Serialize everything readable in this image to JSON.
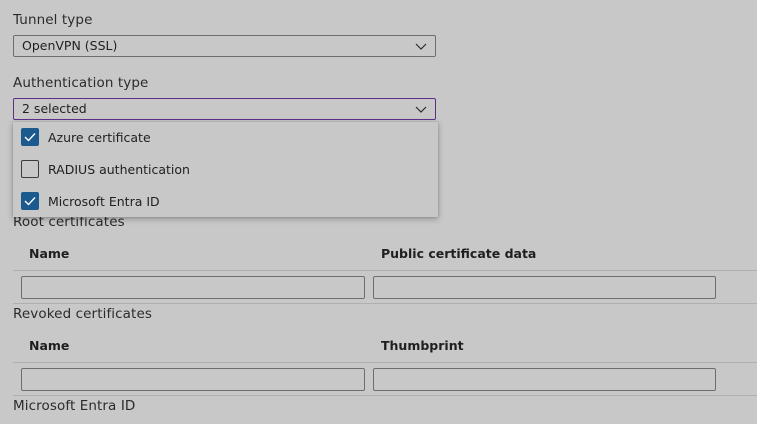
{
  "tunnel_type": {
    "label": "Tunnel type",
    "value": "OpenVPN (SSL)",
    "icon": "chevron-down-icon"
  },
  "authentication_type": {
    "label": "Authentication type",
    "value": "2 selected",
    "icon": "chevron-down-icon",
    "accent_color": "#5e2f8a",
    "options": [
      {
        "label": "Azure certificate",
        "checked": true
      },
      {
        "label": "RADIUS authentication",
        "checked": false
      },
      {
        "label": "Microsoft Entra ID",
        "checked": true
      }
    ]
  },
  "root_certificates": {
    "title": "Root certificates",
    "columns": [
      "Name",
      "Public certificate data"
    ],
    "row": {
      "name": "",
      "data": ""
    }
  },
  "revoked_certificates": {
    "title": "Revoked certificates",
    "columns": [
      "Name",
      "Thumbprint"
    ],
    "row": {
      "name": "",
      "thumbprint": ""
    }
  },
  "entra_section": {
    "title": "Microsoft Entra ID"
  },
  "colors": {
    "background": "#c8c8c8",
    "checkbox_checked": "#1a5a8f"
  }
}
